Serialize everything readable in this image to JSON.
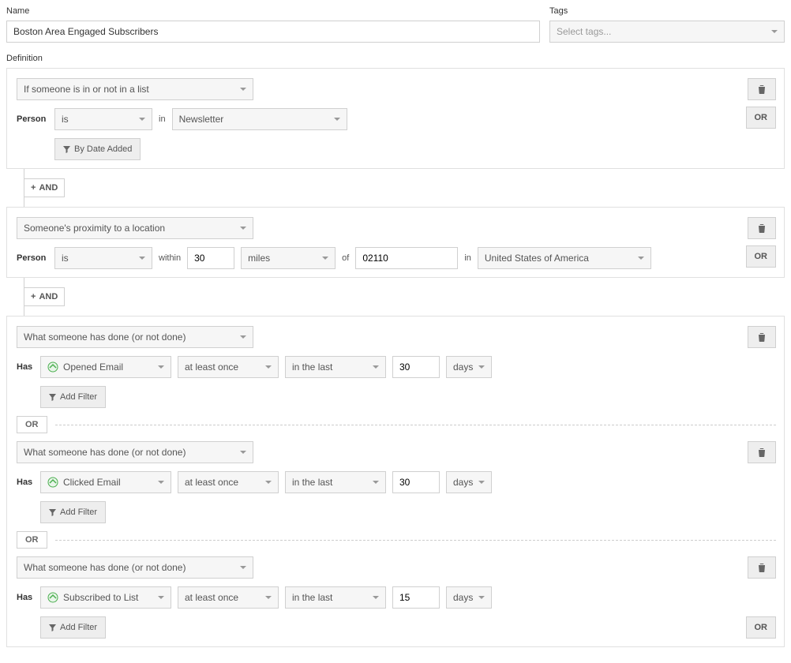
{
  "labels": {
    "name": "Name",
    "tags": "Tags",
    "definition": "Definition",
    "person": "Person",
    "has": "Has",
    "in": "in",
    "within": "within",
    "of": "of",
    "in2": "in",
    "and": "AND",
    "or": "OR",
    "or_sep": "OR"
  },
  "name_value": "Boston Area Engaged Subscribers",
  "tags_placeholder": "Select tags...",
  "buttons": {
    "by_date_added": "By Date Added",
    "add_filter": "Add Filter"
  },
  "group1": {
    "condition": "If someone is in or not in a list",
    "person_op": "is",
    "list": "Newsletter"
  },
  "group2": {
    "condition": "Someone's proximity to a location",
    "person_op": "is",
    "distance": "30",
    "unit": "miles",
    "zip": "02110",
    "country": "United States of America"
  },
  "group3": {
    "blocks": [
      {
        "condition": "What someone has done (or not done)",
        "event": "Opened Email",
        "freq": "at least once",
        "range": "in the last",
        "count": "30",
        "unit": "days"
      },
      {
        "condition": "What someone has done (or not done)",
        "event": "Clicked Email",
        "freq": "at least once",
        "range": "in the last",
        "count": "30",
        "unit": "days"
      },
      {
        "condition": "What someone has done (or not done)",
        "event": "Subscribed to List",
        "freq": "at least once",
        "range": "in the last",
        "count": "15",
        "unit": "days"
      }
    ]
  }
}
